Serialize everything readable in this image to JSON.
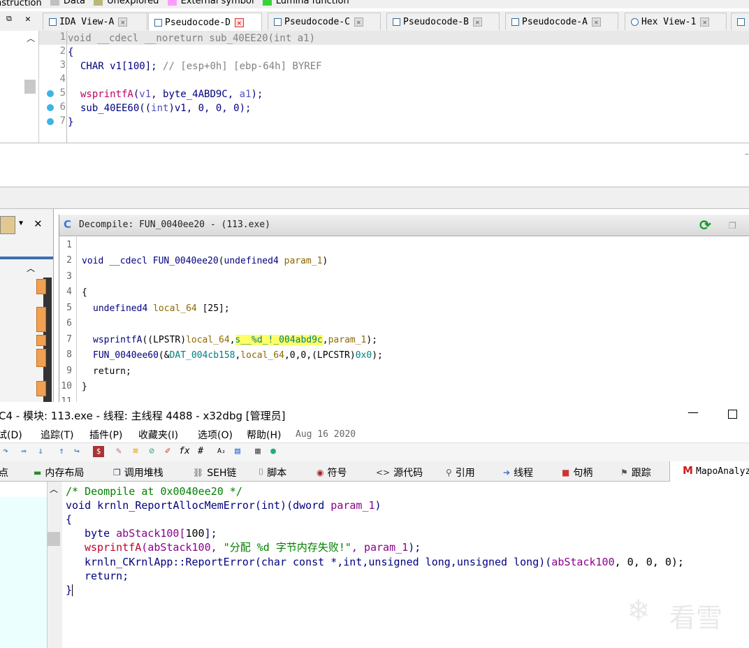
{
  "ida": {
    "legend": [
      {
        "label": "nstruction",
        "color": ""
      },
      {
        "label": "Data",
        "color": "#c0c0c0"
      },
      {
        "label": "Unexplored",
        "color": "#b8b87a"
      },
      {
        "label": "External symbol",
        "color": "#ff9cff"
      },
      {
        "label": "Lumina function",
        "color": "#3ad23a"
      }
    ],
    "tabs": [
      {
        "label": "IDA View-A"
      },
      {
        "label": "Pseudocode-D"
      },
      {
        "label": "Pseudocode-C"
      },
      {
        "label": "Pseudocode-B"
      },
      {
        "label": "Pseudocode-A"
      },
      {
        "label": "Hex View-1"
      }
    ],
    "code": {
      "line_numbers": [
        "1",
        "2",
        "3",
        "4",
        "5",
        "6",
        "7"
      ],
      "l1_sig": "void __cdecl __noreturn sub_40EE20(int a1)",
      "l2": "{",
      "l3_decl": "CHAR v1[100];",
      "l3_comment": "// [esp+0h] [ebp-64h] BYREF",
      "l5_func": "wsprintfA",
      "l5_open": "(",
      "l5_arg1": "v1",
      "l5_sep1": ", ",
      "l5_arg2": "byte_4ABD9C",
      "l5_sep2": ", ",
      "l5_arg3": "a1",
      "l5_close": ");",
      "l6_a": "sub_40EE60((",
      "l6_b": "int",
      "l6_c": ")v1, 0, 0, 0);",
      "l7": "}"
    },
    "hidden_marker": "–"
  },
  "ghidra": {
    "title": "Decompile: FUN_0040ee20 -  (113.exe)",
    "line_numbers": [
      "1",
      "2",
      "3",
      "4",
      "5",
      "6",
      "7",
      "8",
      "9",
      "10"
    ],
    "l2_type": "void",
    "l2_cc": "__cdecl",
    "l2_fn": "FUN_0040ee20",
    "l2_open": "(",
    "l2_ptype": "undefined4",
    "l2_param": "param_1",
    "l2_close": ")",
    "l4": "{",
    "l5_type": "undefined4",
    "l5_var": "local_64",
    "l5_rest": "[25];",
    "l7_fn": "wsprintfA",
    "l7_cast": "((LPSTR)",
    "l7_var": "local_64",
    "l7_comma": ",",
    "l7_str": "s__%d_!_004abd9c",
    "l7_param": "param_1",
    "l7_end": ");",
    "l8_fn": "FUN_0040ee60",
    "l8_amp": "(&",
    "l8_dat": "DAT_004cb158",
    "l8_var": "local_64",
    "l8_rest": ",0,0,(LPCSTR)",
    "l8_hex": "0x0",
    "l8_end": ");",
    "l9": "return;",
    "l10": "}",
    "l11": "11"
  },
  "x64dbg": {
    "title": "C4 - 模块: 113.exe - 线程: 主线程 4488 - x32dbg [管理员]",
    "menu": [
      "试(D)",
      "追踪(T)",
      "插件(P)",
      "收藏夹(I)",
      "选项(O)",
      "帮助(H)"
    ],
    "date": "Aug 16 2020",
    "tabs": [
      {
        "label": "点",
        "icon": ""
      },
      {
        "label": "内存布局",
        "icon": "memory-icon"
      },
      {
        "label": "调用堆栈",
        "icon": "callstack-icon"
      },
      {
        "label": "SEH链",
        "icon": "seh-icon"
      },
      {
        "label": "脚本",
        "icon": "script-icon"
      },
      {
        "label": "符号",
        "icon": "symbol-icon"
      },
      {
        "label": "源代码",
        "icon": "source-icon"
      },
      {
        "label": "引用",
        "icon": "search-icon"
      },
      {
        "label": "线程",
        "icon": "thread-icon"
      },
      {
        "label": "句柄",
        "icon": "handle-icon"
      },
      {
        "label": "跟踪",
        "icon": "trace-icon"
      },
      {
        "label": "MapoAnalyz",
        "icon": "mapo-icon"
      }
    ],
    "code": {
      "l1": "/* Deompile at 0x0040ee20 */",
      "l2_a": "void krnln_ReportAllocMemError(int)(dword ",
      "l2_param": "param_1",
      "l2_b": ")",
      "l3": "{",
      "l4_type": "byte ",
      "l4_var": "abStack100",
      "l4_b1": "[",
      "l4_num": "100",
      "l4_b2": "];",
      "l5_fn": "wsprintfA",
      "l5_open": "(",
      "l5_var": "abStack100",
      "l5_c1": ", ",
      "l5_str": "\"分配 %d 字节内存失败!\"",
      "l5_c2": ", ",
      "l5_param": "param_1",
      "l5_end": ");",
      "l6_a": "krnln_CKrnlApp::",
      "l6_fn": "ReportError",
      "l6_b": "(char const *,int,unsigned long,unsigned long)(",
      "l6_var": "abStack100",
      "l6_c": ", 0, 0, 0);",
      "l7": "return;",
      "l8": "}"
    },
    "watermark": "看雪"
  },
  "colors": {
    "ida_keyword": "#0000ff",
    "ida_string": "#000080",
    "comment_gray": "#808080",
    "ghidra_blue": "#000080",
    "ghidra_var": "#8b6a00",
    "ghidra_highlight": "#ffff66",
    "x_green": "#008000",
    "x_purple": "#8b008b",
    "x_blue": "#0000a0"
  }
}
